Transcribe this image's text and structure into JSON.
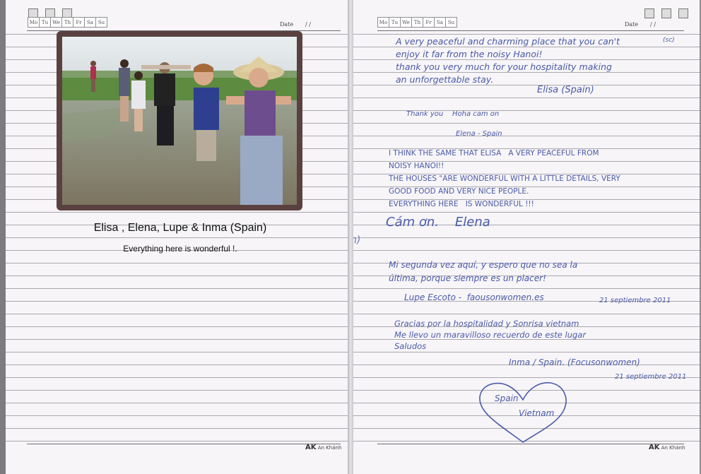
{
  "weekdays": [
    "Mo",
    "Tu",
    "We",
    "Th",
    "Fr",
    "Sa",
    "Su"
  ],
  "date_label": "Date",
  "date_slashes": "/        /",
  "left_page": {
    "caption_title": "Elisa , Elena, Lupe & Inma (Spain)",
    "caption_text": "Everything here is wonderful !.",
    "margin_note": "n)"
  },
  "right_page": {
    "entry1": "A very peaceful and charming place that you can't\nenjoy it far from the noisy Hanoi!\nthank you very much for your hospitality making\nan unforgettable stay.",
    "entry1_sig": "Elisa (Spain)",
    "entry1_note": "(sc)",
    "entry2": "Thank you    Hoha cam on",
    "entry2_sig": "Elena - Spain",
    "entry3": "I THINK THE SAME THAT ELISA   A VERY PEACEFUL FROM\nNOISY HANOI!!\nTHE HOUSES \"ARE WONDERFUL WITH A LITTLE DETAILS, VERY\nGOOD FOOD AND VERY NICE PEOPLE.\nEVERYTHING HERE   IS WONDERFUL !!!",
    "entry3_sig": "Cám ơn.    Elena",
    "entry4": "Mi segunda vez aquí, y espero que no sea la\núltima, porque siempre es un placer!",
    "entry4_sig": "Lupe Escoto -  faousonwomen.es",
    "entry4_date": "21 septiembre 2011",
    "entry5": "Gracias por la hospitalidad y Sonrisa vietnam\nMe llevo un maravilloso recuerdo de este lugar\nSaludos",
    "entry5_sig": "Inma / Spain. (Focusonwomen)",
    "entry5_date": "21 septiembre 2011",
    "heart_line1": "Spain",
    "heart_line2": "Vietnam"
  },
  "logo_text": "AK",
  "logo_sub": "An Khánh",
  "colors": {
    "ink": "#4a5aa8",
    "frame": "#5a4140",
    "paper": "#f7f5f8"
  }
}
